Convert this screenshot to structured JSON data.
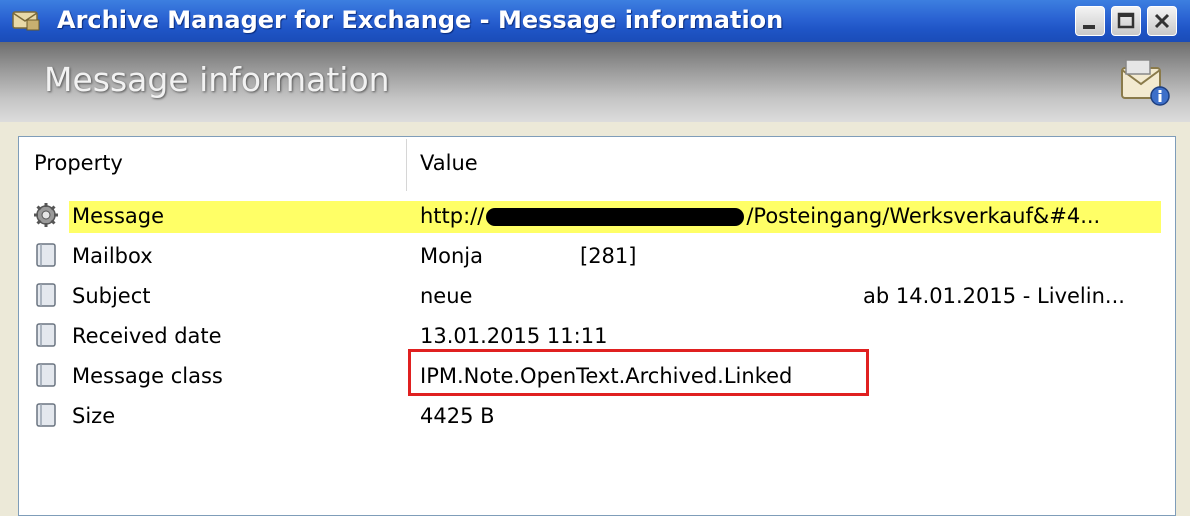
{
  "window": {
    "title": "Archive Manager for Exchange - Message information",
    "app_icon": "envelope-archive-icon",
    "controls": [
      "minimize-icon",
      "maximize-icon",
      "close-icon"
    ]
  },
  "header": {
    "title": "Message information",
    "icon": "message-info-icon"
  },
  "table": {
    "columns": {
      "property": "Property",
      "value": "Value"
    },
    "rows": [
      {
        "icon": "gear-icon",
        "property": "Message",
        "value_prefix": "http://",
        "value_suffix": "/Posteingang/Werksverkauf&#4...",
        "highlighted": true
      },
      {
        "icon": "page-icon",
        "property": "Mailbox",
        "value": "Monja",
        "value_extra": "[281]"
      },
      {
        "icon": "page-icon",
        "property": "Subject",
        "value": "neue",
        "value_extra": "ab 14.01.2015 - Livelin..."
      },
      {
        "icon": "page-icon",
        "property": "Received date",
        "value": "13.01.2015 11:11"
      },
      {
        "icon": "page-icon",
        "property": "Message class",
        "value": "IPM.Note.OpenText.Archived.Linked",
        "boxed": true
      },
      {
        "icon": "page-icon",
        "property": "Size",
        "value": "4425 B"
      }
    ]
  },
  "colors": {
    "titlebar": "#2a62d2",
    "highlight": "#ffff66",
    "callout_border": "#e02020"
  }
}
